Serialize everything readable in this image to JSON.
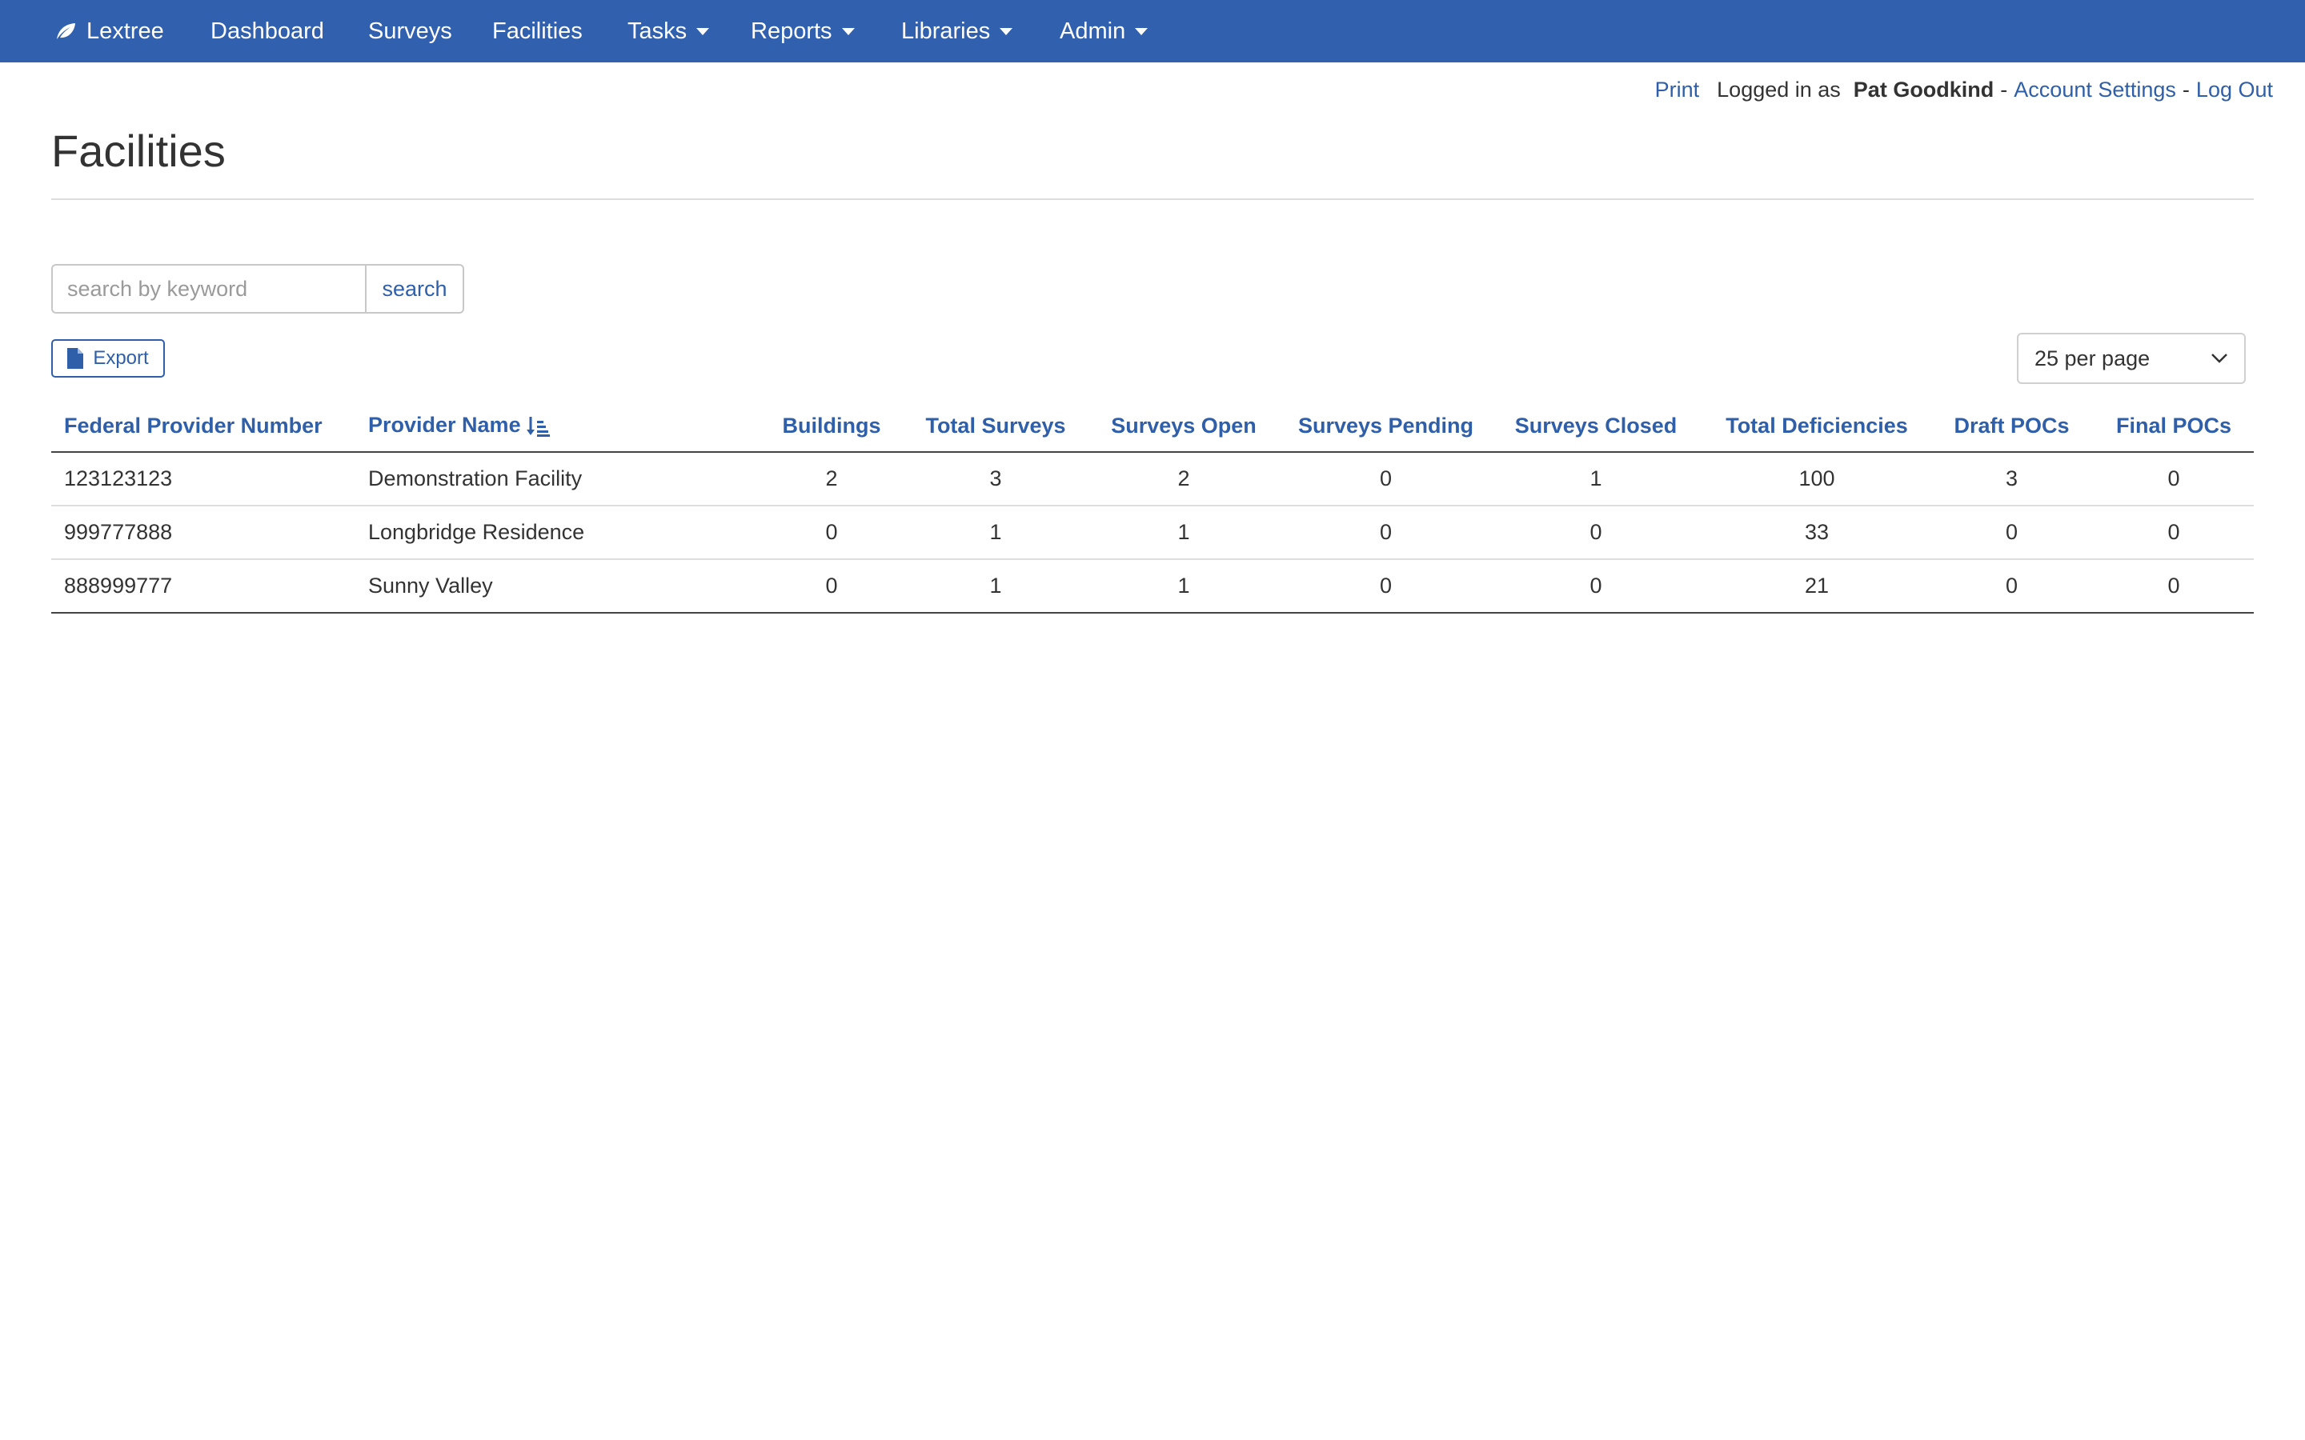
{
  "navbar": {
    "brand": "Lextree",
    "items": [
      {
        "label": "Dashboard",
        "dropdown": false
      },
      {
        "label": "Surveys",
        "dropdown": false
      },
      {
        "label": "Facilities",
        "dropdown": false
      },
      {
        "label": "Tasks",
        "dropdown": true
      },
      {
        "label": "Reports",
        "dropdown": true
      },
      {
        "label": "Libraries",
        "dropdown": true
      },
      {
        "label": "Admin",
        "dropdown": true
      }
    ],
    "background": "#3060ae"
  },
  "userbar": {
    "print": "Print",
    "logged_in_as": "Logged in as",
    "username": "Pat Goodkind",
    "separator": "-",
    "account_settings": "Account Settings",
    "log_out": "Log Out"
  },
  "page": {
    "title": "Facilities"
  },
  "search": {
    "placeholder": "search by keyword",
    "value": "",
    "button": "search"
  },
  "export": {
    "label": "Export",
    "icon": "file-icon"
  },
  "per_page": {
    "selected": "25 per page"
  },
  "table": {
    "sort_column": "Provider Name",
    "sort_icon": "sort-alpha-down-icon",
    "columns": [
      "Federal Provider Number",
      "Provider Name",
      "Buildings",
      "Total Surveys",
      "Surveys Open",
      "Surveys Pending",
      "Surveys Closed",
      "Total Deficiencies",
      "Draft POCs",
      "Final POCs"
    ],
    "rows": [
      [
        "123123123",
        "Demonstration Facility",
        "2",
        "3",
        "2",
        "0",
        "1",
        "100",
        "3",
        "0"
      ],
      [
        "999777888",
        "Longbridge Residence",
        "0",
        "1",
        "1",
        "0",
        "0",
        "33",
        "0",
        "0"
      ],
      [
        "888999777",
        "Sunny Valley",
        "0",
        "1",
        "1",
        "0",
        "0",
        "21",
        "0",
        "0"
      ]
    ]
  },
  "colors": {
    "link": "#2f5fa9",
    "text": "#333333"
  }
}
